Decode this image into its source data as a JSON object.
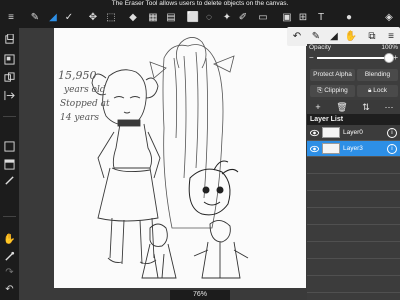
{
  "hint": "The Eraser Tool allows users to delete objects on the canvas.",
  "toolbar": {
    "tools": [
      {
        "name": "menu-icon",
        "glyph": "≡"
      },
      {
        "name": "brush-icon",
        "glyph": "✎"
      },
      {
        "name": "eraser-icon",
        "glyph": "◢",
        "active": true
      },
      {
        "name": "smudge-icon",
        "glyph": "✓"
      },
      {
        "name": "move-icon",
        "glyph": "✥"
      },
      {
        "name": "transform-icon",
        "glyph": "⬚"
      },
      {
        "name": "bucket-icon",
        "glyph": "◆"
      },
      {
        "name": "gradient-icon",
        "glyph": "▦"
      },
      {
        "name": "fill-icon",
        "glyph": "▤"
      },
      {
        "name": "select-rect-icon",
        "glyph": "⬜"
      },
      {
        "name": "lasso-icon",
        "glyph": "◌"
      },
      {
        "name": "magic-wand-icon",
        "glyph": "✦"
      },
      {
        "name": "select-pen-icon",
        "glyph": "✐"
      },
      {
        "name": "select-eraser-icon",
        "glyph": "▭"
      },
      {
        "name": "frame-icon",
        "glyph": "▣"
      },
      {
        "name": "balloon-icon",
        "glyph": "⊞"
      },
      {
        "name": "text-icon",
        "glyph": "T"
      },
      {
        "name": "chat-icon",
        "glyph": "●"
      },
      {
        "name": "layers-icon",
        "glyph": "◈"
      }
    ]
  },
  "brush_popover": {
    "items": [
      {
        "name": "undo-icon",
        "glyph": "↶"
      },
      {
        "name": "pen-icon",
        "glyph": "✎"
      },
      {
        "name": "eraser-small-icon",
        "glyph": "◢"
      },
      {
        "name": "hand-icon",
        "glyph": "✋"
      },
      {
        "name": "layer-stack-icon",
        "glyph": "⧉"
      },
      {
        "name": "menu-small-icon",
        "glyph": "≡"
      }
    ]
  },
  "panel": {
    "opacity_label": "Opacity",
    "opacity_value": "100%",
    "opacity_fraction": 1.0,
    "protect_alpha": "Protect Alpha",
    "blending": "Blending",
    "clipping": "Clipping",
    "lock": "Lock",
    "layer_list_title": "Layer List",
    "layers": [
      {
        "name": "Layer0",
        "selected": false
      },
      {
        "name": "Layer3",
        "selected": true
      }
    ]
  },
  "canvas_note": [
    "15,950",
    "years old",
    "Stopped at",
    "14 years"
  ],
  "zoom": "76%",
  "colors": {
    "accent": "#2d8fe6",
    "selected_layer": "#2d8fe6",
    "toolbar_bg": "#1c1c1c",
    "canvas_bg": "#fbfbfb"
  }
}
